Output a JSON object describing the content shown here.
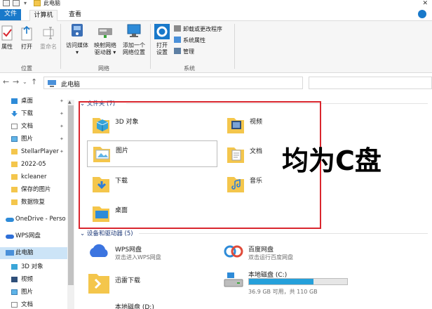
{
  "window": {
    "title": "此电脑",
    "close_glyph": "✕"
  },
  "ribbon_tabs": {
    "file": "文件",
    "computer": "计算机",
    "view": "查看"
  },
  "ribbon": {
    "location_group": "位置",
    "network_group": "网络",
    "system_group": "系统",
    "properties": "属性",
    "open": "打开",
    "rename": "重命名",
    "access_media": [
      "访问媒体",
      "▾"
    ],
    "map_drive": [
      "映射网络",
      "驱动器 ▾"
    ],
    "add_location": [
      "添加一个",
      "网络位置"
    ],
    "open_settings": [
      "打开",
      "设置"
    ],
    "uninstall": "卸载或更改程序",
    "system_props": "系统属性",
    "manage": "管理"
  },
  "address": {
    "path": "此电脑",
    "up_glyph": "↑",
    "back_glyph": "←",
    "forward_glyph": "→",
    "dropdown_glyph": "⌄"
  },
  "nav": {
    "items": [
      {
        "label": "桌面",
        "pinned": true
      },
      {
        "label": "下载",
        "pinned": true
      },
      {
        "label": "文档",
        "pinned": true
      },
      {
        "label": "图片",
        "pinned": true
      },
      {
        "label": "StellarPlayer",
        "pinned": true
      },
      {
        "label": "2022-05",
        "pinned": false
      },
      {
        "label": "kcleaner",
        "pinned": false
      },
      {
        "label": "保存的图片",
        "pinned": false
      },
      {
        "label": "数据恢复",
        "pinned": false
      },
      {
        "label": "OneDrive - Perso",
        "pinned": false
      },
      {
        "label": "WPS网盘",
        "pinned": false
      },
      {
        "label": "此电脑",
        "pinned": false
      },
      {
        "label": "3D 对象",
        "pinned": false
      },
      {
        "label": "视频",
        "pinned": false
      },
      {
        "label": "图片",
        "pinned": false
      },
      {
        "label": "文档",
        "pinned": false
      }
    ],
    "pin_glyph": "✦"
  },
  "folders": {
    "heading": "文件夹 (7)",
    "items": [
      "3D 对象",
      "视频",
      "图片",
      "文档",
      "下载",
      "音乐",
      "桌面"
    ]
  },
  "annotation": "均为C盘",
  "devices": {
    "heading": "设备和驱动器 (5)",
    "wps": {
      "name": "WPS网盘",
      "sub": "双击进入WPS网盘"
    },
    "baidu": {
      "name": "百度网盘",
      "sub": "双击运行百度网盘"
    },
    "xunlei": {
      "name": "迅雷下载"
    },
    "local_c": {
      "name": "本地磁盘 (C:)",
      "sub": "36.9 GB 可用，共 110 GB",
      "used_fraction": 0.66
    },
    "local_d": {
      "name": "本地磁盘 (D:)"
    }
  },
  "colors": {
    "accent": "#1979ca",
    "selection": "#cce4f7",
    "highlight_box": "#d9262e",
    "drive_fill": "#26a0da",
    "folder_yellow": "#f4c64c"
  }
}
